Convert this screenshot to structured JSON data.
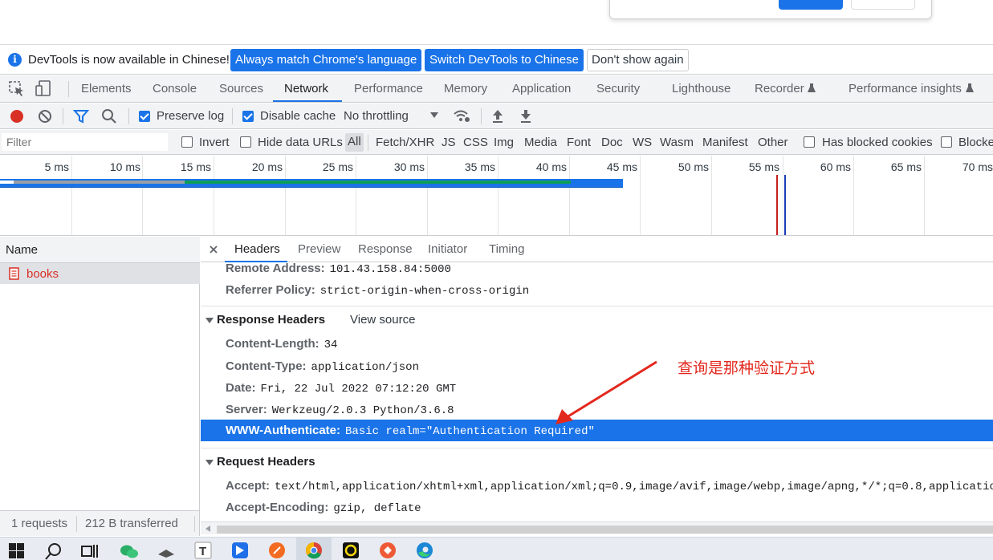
{
  "infobar": {
    "message": "DevTools is now available in Chinese!",
    "btn_match": "Always match Chrome's language",
    "btn_switch": "Switch DevTools to Chinese",
    "btn_dismiss": "Don't show again"
  },
  "tabs": [
    "Elements",
    "Console",
    "Sources",
    "Network",
    "Performance",
    "Memory",
    "Application",
    "Security",
    "Lighthouse",
    "Recorder",
    "Performance insights"
  ],
  "active_tab": "Network",
  "toolbar": {
    "preserve_log": "Preserve log",
    "disable_cache": "Disable cache",
    "throttling": "No throttling"
  },
  "filterbar": {
    "placeholder": "Filter",
    "invert": "Invert",
    "hide_data_urls": "Hide data URLs",
    "types": [
      "All",
      "Fetch/XHR",
      "JS",
      "CSS",
      "Img",
      "Media",
      "Font",
      "Doc",
      "WS",
      "Wasm",
      "Manifest",
      "Other"
    ],
    "has_blocked_cookies": "Has blocked cookies",
    "blocked": "Blocke"
  },
  "timeline": {
    "ticks": [
      "5 ms",
      "10 ms",
      "15 ms",
      "20 ms",
      "25 ms",
      "30 ms",
      "35 ms",
      "40 ms",
      "45 ms",
      "50 ms",
      "55 ms",
      "60 ms",
      "65 ms",
      "70 ms"
    ]
  },
  "requests": {
    "header": "Name",
    "items": [
      {
        "name": "books"
      }
    ],
    "status_count": "1 requests",
    "status_transferred": "212 B transferred"
  },
  "detail": {
    "tabs": [
      "Headers",
      "Preview",
      "Response",
      "Initiator",
      "Timing"
    ],
    "active_tab": "Headers",
    "general": [
      {
        "k": "Remote Address:",
        "v": "101.43.158.84:5000"
      },
      {
        "k": "Referrer Policy:",
        "v": "strict-origin-when-cross-origin"
      }
    ],
    "response_title": "Response Headers",
    "view_source": "View source",
    "response_headers": [
      {
        "k": "Content-Length:",
        "v": "34"
      },
      {
        "k": "Content-Type:",
        "v": "application/json"
      },
      {
        "k": "Date:",
        "v": "Fri, 22 Jul 2022 07:12:20 GMT"
      },
      {
        "k": "Server:",
        "v": "Werkzeug/2.0.3 Python/3.6.8"
      },
      {
        "k": "WWW-Authenticate:",
        "v": "Basic realm=\"Authentication Required\""
      }
    ],
    "request_title": "Request Headers",
    "request_headers": [
      {
        "k": "Accept:",
        "v": "text/html,application/xhtml+xml,application/xml;q=0.9,image/avif,image/webp,image/apng,*/*;q=0.8,application/"
      },
      {
        "k": "Accept-Encoding:",
        "v": "gzip, deflate"
      }
    ]
  },
  "annotation": "查询是那种验证方式",
  "colors": {
    "accent": "#1a73e8",
    "annotation": "#e3281e"
  }
}
